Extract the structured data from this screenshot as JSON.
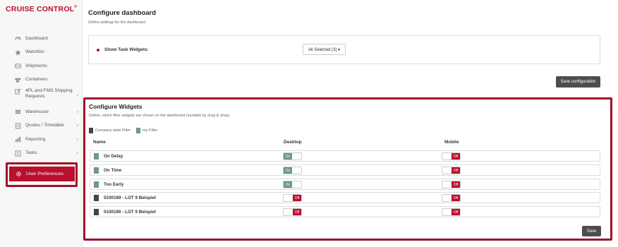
{
  "app": {
    "logo": "CRUISE CONTROL",
    "logo_mark": "®"
  },
  "sidebar": {
    "items": [
      {
        "label": "Dashboard",
        "icon": "dashboard-icon",
        "chevron": false
      },
      {
        "label": "Watchlist",
        "icon": "star-icon",
        "chevron": false
      },
      {
        "label": "Shipments",
        "icon": "shipments-icon",
        "chevron": false
      },
      {
        "label": "Containers",
        "icon": "containers-icon",
        "chevron": false
      },
      {
        "label": "4PL and FMS Shipping Requests",
        "icon": "edit-icon",
        "chevron": true
      },
      {
        "label": "Warehouse",
        "icon": "warehouse-icon",
        "chevron": true
      },
      {
        "label": "Quotes / Timetable",
        "icon": "quotes-icon",
        "chevron": true
      },
      {
        "label": "Reporting",
        "icon": "reporting-icon",
        "chevron": true
      },
      {
        "label": "Tasks",
        "icon": "tasks-icon",
        "chevron": true
      }
    ],
    "chevron_glyph": "›",
    "user_preferences": {
      "label": "User Preferences",
      "icon": "gear-icon"
    }
  },
  "dashboard": {
    "title": "Configure dashboard",
    "subtitle": "Define settings for the dashboard",
    "show_task_widgets_label": "Show Task Widgets:",
    "dropdown_value": "All Selected (3) ▾",
    "save_configuration_label": "Save configuration"
  },
  "widgets": {
    "title": "Configure Widgets",
    "subtitle": "Define, which filter widgets are shown on the dashboard (sortable by drag & drop).",
    "legend": [
      {
        "label": "Company wide Filter",
        "color": "#444444"
      },
      {
        "label": "my Filter",
        "color": "#6f958d"
      }
    ],
    "columns": {
      "name": "Name",
      "desktop": "Desktop",
      "mobile": "Mobile"
    },
    "rows": [
      {
        "name": "On Delay",
        "type": "teal",
        "desktop": "On",
        "mobile": "Off"
      },
      {
        "name": "On Time",
        "type": "teal",
        "desktop": "On",
        "mobile": "Off"
      },
      {
        "name": "Too Early",
        "type": "teal",
        "desktop": "On",
        "mobile": "Off"
      },
      {
        "name": "5330189 - LOT 9 Beispiel",
        "type": "dark",
        "desktop": "Off",
        "mobile": "Off"
      },
      {
        "name": "5330190 - LOT 9 Beispiel",
        "type": "dark",
        "desktop": "Off",
        "mobile": "Off"
      }
    ],
    "save_label": "Save"
  },
  "colors": {
    "brand": "#b8102d",
    "on": "#6f958d",
    "button_dark": "#4d4d4d"
  }
}
